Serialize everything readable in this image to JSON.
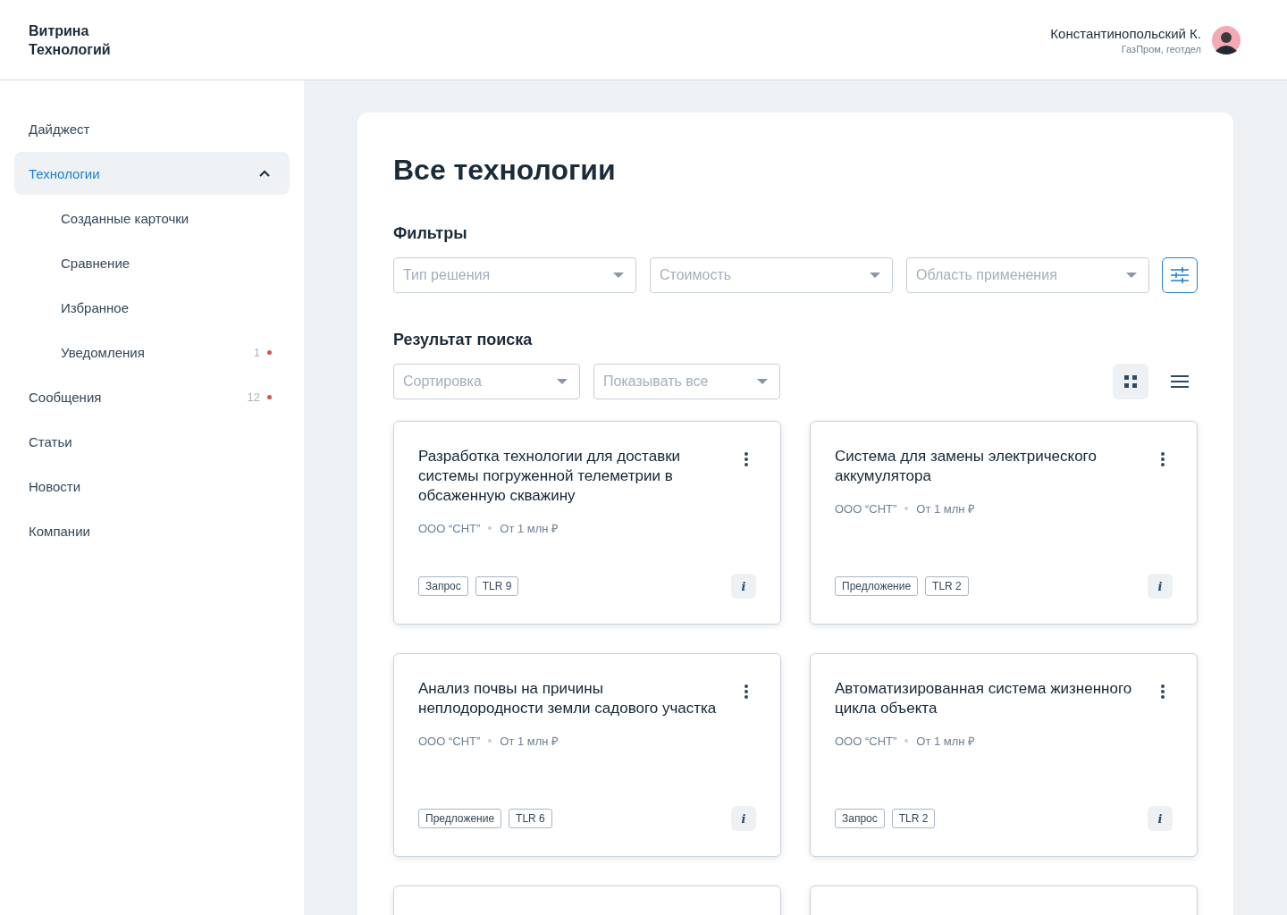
{
  "header": {
    "logo": [
      "Витрина",
      "Технологий"
    ],
    "user": {
      "name": "Константинопольский К.",
      "org": "ГазПром, геотдел"
    }
  },
  "sidebar": {
    "items": [
      {
        "label": "Дайджест",
        "selected": false
      },
      {
        "label": "Технологии",
        "selected": true,
        "expanded": true,
        "children": [
          {
            "label": "Созданные карточки",
            "selected": false
          },
          {
            "label": "Сравнение",
            "selected": false
          },
          {
            "label": "Избранное",
            "selected": false
          },
          {
            "label": "Уведомления",
            "selected": false,
            "count": "1",
            "color": "#d9534f"
          }
        ]
      },
      {
        "label": "Сообщения",
        "selected": false,
        "count": "12",
        "color": "#d9534f"
      },
      {
        "label": "Статьи",
        "selected": false
      },
      {
        "label": "Новости",
        "selected": false
      },
      {
        "label": "Компании",
        "selected": false
      }
    ]
  },
  "main": {
    "title": "Все технологии",
    "filters_title": "Фильтры",
    "filters": [
      {
        "placeholder": "Тип решения"
      },
      {
        "placeholder": "Стоимость"
      },
      {
        "placeholder": "Область применения"
      }
    ],
    "results_title": "Результат поиска",
    "sort_controls": [
      {
        "placeholder": "Сортировка"
      },
      {
        "placeholder": "Показывать все"
      }
    ],
    "view_modes": [
      {
        "kind": "grid",
        "selected": true
      },
      {
        "kind": "list",
        "selected": false
      }
    ],
    "cards": [
      {
        "title": "Разработка технологии для доставки системы погруженной телеметрии в обсаженную скважину",
        "company": "ООО “СНТ”",
        "price": "От 1 млн ₽",
        "tags": [
          "Запрос",
          "TLR 9"
        ],
        "info": "i"
      },
      {
        "title": "Система для замены электрического аккумулятора",
        "company": "ООО “СНТ”",
        "price": "От 1 млн ₽",
        "tags": [
          "Предложение",
          "TLR 2"
        ],
        "info": "i"
      },
      {
        "title": "Анализ почвы на причины неплодородности земли садового участка",
        "company": "ООО “СНТ”",
        "price": "От 1 млн ₽",
        "tags": [
          "Предложение",
          "TLR 6"
        ],
        "info": "i"
      },
      {
        "title": "Автоматизированная система жизненного цикла объекта",
        "company": "ООО “СНТ”",
        "price": "От 1 млн ₽",
        "tags": [
          "Запрос",
          "TLR 2"
        ],
        "info": "i"
      }
    ]
  }
}
